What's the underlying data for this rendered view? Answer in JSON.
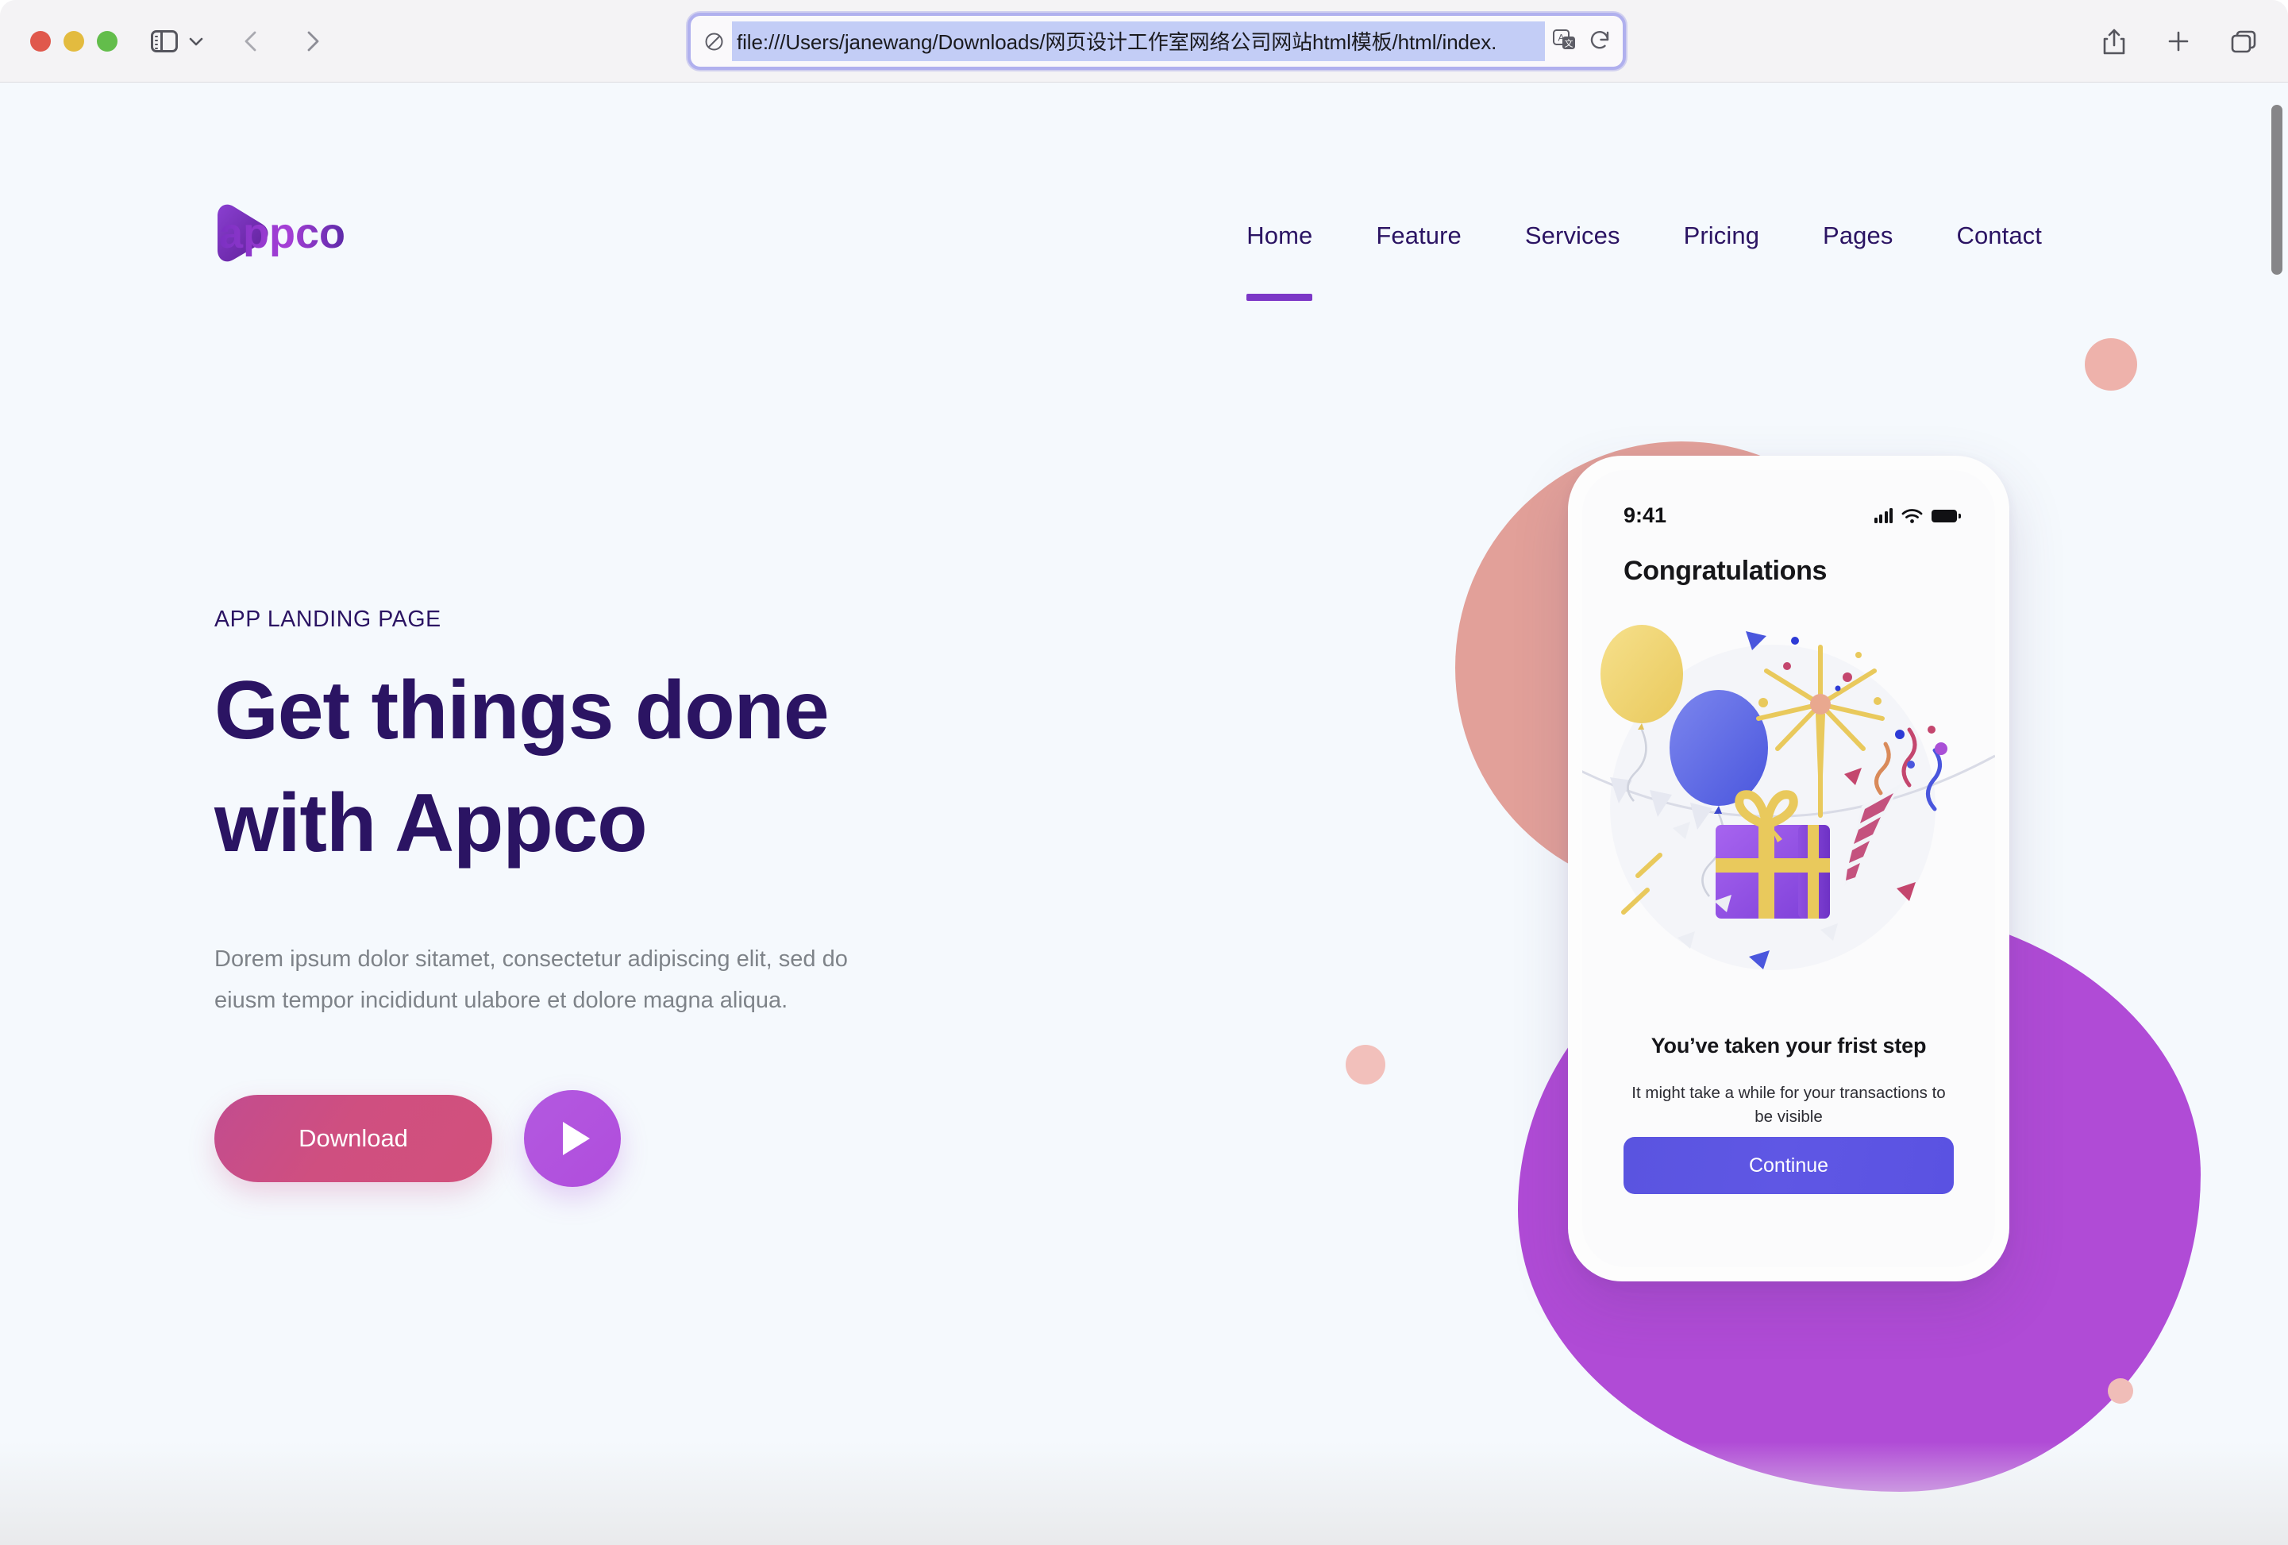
{
  "browser": {
    "window_controls": [
      "close",
      "minimize",
      "maximize"
    ],
    "sidebar_icon": "sidebar-icon",
    "tab_overview_chevron_icon": "chevron-down-icon",
    "back_icon": "chevron-left-icon",
    "forward_icon": "chevron-right-icon",
    "url": "file:///Users/janewang/Downloads/网页设计工作室网络公司网站html模板/html/index.",
    "url_shield_icon": "shield-slash-icon",
    "translate_icon": "translate-icon",
    "reload_icon": "reload-icon",
    "share_icon": "share-icon",
    "new_tab_icon": "plus-icon",
    "tabs_icon": "tabs-icon"
  },
  "site": {
    "logo_text": "appco",
    "nav": [
      {
        "label": "Home",
        "active": true
      },
      {
        "label": "Feature",
        "active": false
      },
      {
        "label": "Services",
        "active": false
      },
      {
        "label": "Pricing",
        "active": false
      },
      {
        "label": "Pages",
        "active": false
      },
      {
        "label": "Contact",
        "active": false
      }
    ],
    "hero": {
      "eyebrow": "APP LANDING PAGE",
      "title_line1": "Get things done",
      "title_line2": "with Appco",
      "paragraph": "Dorem ipsum dolor sitamet, consectetur adipiscing elit, sed do eiusm tempor incididunt ulabore et dolore magna aliqua.",
      "download_label": "Download",
      "play_icon": "play-icon"
    },
    "phone": {
      "status_time": "9:41",
      "signal_icon": "signal-bars-icon",
      "wifi_icon": "wifi-icon",
      "battery_icon": "battery-icon",
      "heading": "Congratulations",
      "illustration": "celebration-illustration",
      "subheading": "You’ve taken your frist step",
      "body": "It might take a while for your transactions to be visible",
      "continue_label": "Continue"
    }
  },
  "colors": {
    "page_bg": "#f5f9fd",
    "heading": "#2b1463",
    "nav_accent": "#7c38c7",
    "download_btn": "#cf4f80",
    "play_btn": "#b04ddc",
    "blob_salmon": "#e2a099",
    "blob_purple": "#b04bd6",
    "continue_btn": "#5a54e0"
  }
}
